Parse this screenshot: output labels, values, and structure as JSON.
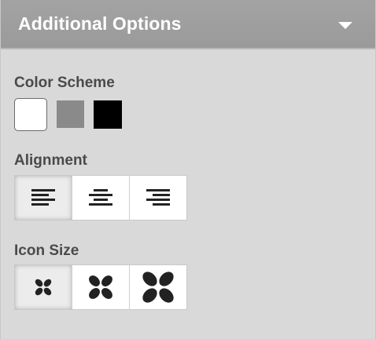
{
  "header": {
    "title": "Additional Options",
    "icon": "chevron-down-icon"
  },
  "color_scheme": {
    "label": "Color Scheme",
    "options": [
      {
        "name": "white",
        "color": "#ffffff",
        "selected": true
      },
      {
        "name": "gray",
        "color": "#8a8a8a",
        "selected": false
      },
      {
        "name": "black",
        "color": "#000000",
        "selected": false
      }
    ]
  },
  "alignment": {
    "label": "Alignment",
    "options": [
      {
        "name": "left",
        "icon": "align-left-icon",
        "selected": true
      },
      {
        "name": "center",
        "icon": "align-center-icon",
        "selected": false
      },
      {
        "name": "right",
        "icon": "align-right-icon",
        "selected": false
      }
    ]
  },
  "icon_size": {
    "label": "Icon Size",
    "options": [
      {
        "name": "small",
        "icon": "flower-small-icon",
        "selected": true
      },
      {
        "name": "medium",
        "icon": "flower-medium-icon",
        "selected": false
      },
      {
        "name": "large",
        "icon": "flower-large-icon",
        "selected": false
      }
    ]
  },
  "colors": {
    "header_bg": "#9e9e9e",
    "panel_bg": "#d9d9d9",
    "label_text": "#4a4a4a",
    "icon": "#222222"
  }
}
